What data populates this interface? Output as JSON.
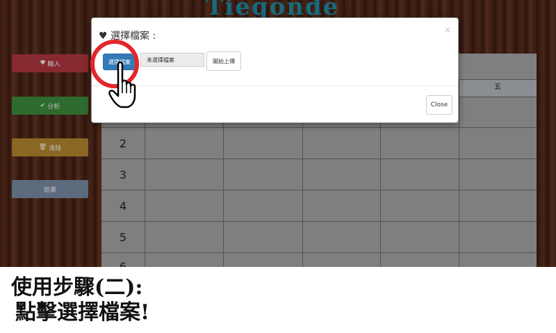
{
  "app": {
    "logo": "Tiegonde"
  },
  "sidebar": {
    "input_label": "輸入",
    "analyze_label": "分析",
    "clear_label": "清除",
    "result_label": "結果",
    "colors": {
      "input": "#b5393f",
      "analyze": "#3f8e3e",
      "clear": "#b88a2e",
      "result": "#7d8fa8"
    }
  },
  "table": {
    "day_header": "五",
    "row_numbers": [
      "2",
      "3",
      "4",
      "5",
      "6"
    ]
  },
  "modal": {
    "title": "選擇檔案 :",
    "close_x": "×",
    "choose_file_label": "選擇檔案",
    "no_file_text": "未選擇檔案",
    "upload_label": "開始上傳",
    "close_label": "Close"
  },
  "annotation": {
    "ring_color": "#e3262c"
  },
  "caption": {
    "line1": "使用步驟(二):",
    "line2": "點擊選擇檔案!"
  },
  "icons": {
    "title": "heart-icon",
    "input": "heart-icon",
    "analyze": "check-circle-icon",
    "clear": "trash-icon",
    "pointer": "hand-pointer-icon"
  }
}
